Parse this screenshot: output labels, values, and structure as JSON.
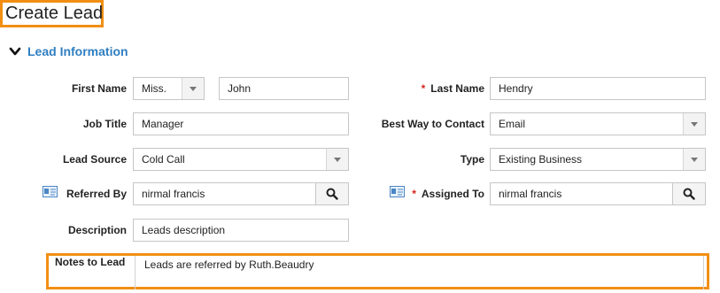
{
  "page": {
    "title": "Create Lead"
  },
  "section": {
    "title": "Lead Information",
    "chevron_icon": "chevron-down-icon"
  },
  "fields": {
    "first_name": {
      "label": "First Name",
      "salutation": "Miss.",
      "value": "John"
    },
    "last_name": {
      "label": "Last Name",
      "required_mark": "*",
      "value": "Hendry"
    },
    "job_title": {
      "label": "Job Title",
      "value": "Manager"
    },
    "best_way_to_contact": {
      "label": "Best Way to Contact",
      "value": "Email"
    },
    "lead_source": {
      "label": "Lead Source",
      "value": "Cold Call"
    },
    "type": {
      "label": "Type",
      "value": "Existing Business"
    },
    "referred_by": {
      "label": "Referred By",
      "value": "nirmal francis",
      "icon": "contact-card-icon",
      "lookup_icon": "search-icon"
    },
    "assigned_to": {
      "label": "Assigned To",
      "required_mark": "*",
      "value": "nirmal francis",
      "icon": "contact-card-icon",
      "lookup_icon": "search-icon"
    },
    "description": {
      "label": "Description",
      "value": "Leads description"
    },
    "notes_to_lead": {
      "label": "Notes to Lead",
      "value": "Leads are referred by Ruth.Beaudry"
    }
  },
  "colors": {
    "highlight": "#f28f13",
    "section_title": "#2f7ec1",
    "required": "#d9241b"
  }
}
